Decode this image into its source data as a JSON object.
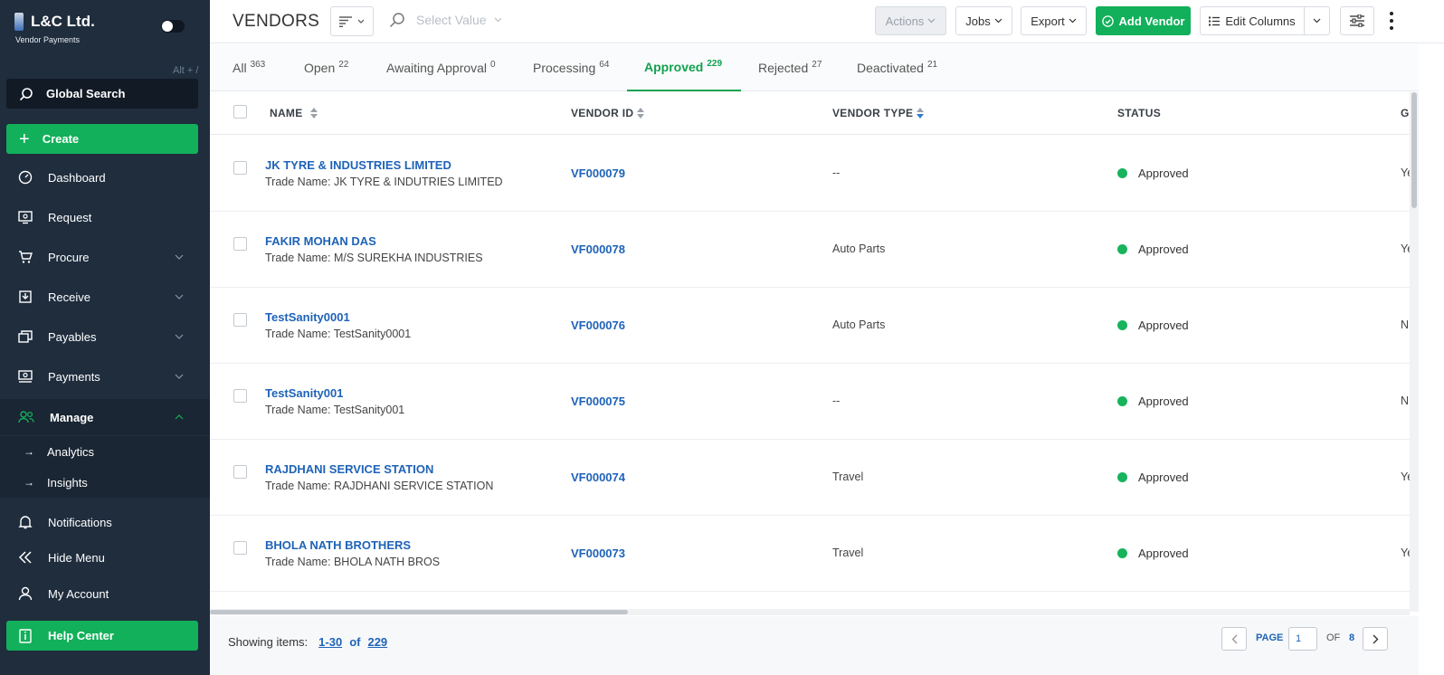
{
  "sidebar": {
    "brand_name": "L&C Ltd.",
    "brand_sub": "Vendor Payments",
    "shortcut": "Alt + /",
    "global_search": "Global Search",
    "create": "Create",
    "items": [
      {
        "label": "Dashboard",
        "icon": "dashboard-icon"
      },
      {
        "label": "Request",
        "icon": "request-icon"
      },
      {
        "label": "Procure",
        "icon": "cart-icon",
        "expandable": true
      },
      {
        "label": "Receive",
        "icon": "receive-icon",
        "expandable": true
      },
      {
        "label": "Payables",
        "icon": "payables-icon",
        "expandable": true
      },
      {
        "label": "Payments",
        "icon": "payments-icon",
        "expandable": true
      },
      {
        "label": "Manage",
        "icon": "users-icon",
        "expanded": true
      }
    ],
    "sub_items": [
      "Analytics",
      "Insights"
    ],
    "bottom": [
      {
        "label": "Notifications",
        "icon": "bell-icon"
      },
      {
        "label": "Hide Menu",
        "icon": "double-chevron-left-icon"
      },
      {
        "label": "My Account",
        "icon": "user-icon"
      }
    ],
    "help_center": "Help Center"
  },
  "header": {
    "title": "VENDORS",
    "select_placeholder": "Select Value",
    "actions": "Actions",
    "jobs": "Jobs",
    "export": "Export",
    "add_vendor": "Add Vendor",
    "edit_columns": "Edit Columns"
  },
  "tabs": [
    {
      "label": "All",
      "count": "363"
    },
    {
      "label": "Open",
      "count": "22"
    },
    {
      "label": "Awaiting Approval",
      "count": "0"
    },
    {
      "label": "Processing",
      "count": "64"
    },
    {
      "label": "Approved",
      "count": "229",
      "active": true
    },
    {
      "label": "Rejected",
      "count": "27"
    },
    {
      "label": "Deactivated",
      "count": "21"
    }
  ],
  "table": {
    "columns": [
      "NAME",
      "VENDOR ID",
      "VENDOR TYPE",
      "STATUS",
      "G"
    ],
    "rows": [
      {
        "name": "JK TYRE & INDUSTRIES LIMITED",
        "trade": "Trade Name: JK TYRE & INDUTRIES LIMITED",
        "vendor_id": "VF000079",
        "type": "--",
        "status": "Approved",
        "g": "Ye"
      },
      {
        "name": "FAKIR MOHAN DAS",
        "trade": "Trade Name: M/S SUREKHA INDUSTRIES",
        "vendor_id": "VF000078",
        "type": "Auto Parts",
        "status": "Approved",
        "g": "Ye"
      },
      {
        "name": "TestSanity0001",
        "trade": "Trade Name: TestSanity0001",
        "vendor_id": "VF000076",
        "type": "Auto Parts",
        "status": "Approved",
        "g": "N"
      },
      {
        "name": "TestSanity001",
        "trade": "Trade Name: TestSanity001",
        "vendor_id": "VF000075",
        "type": "--",
        "status": "Approved",
        "g": "N"
      },
      {
        "name": "RAJDHANI SERVICE STATION",
        "trade": "Trade Name: RAJDHANI SERVICE STATION",
        "vendor_id": "VF000074",
        "type": "Travel",
        "status": "Approved",
        "g": "Ye"
      },
      {
        "name": "BHOLA NATH BROTHERS",
        "trade": "Trade Name: BHOLA NATH BROS",
        "vendor_id": "VF000073",
        "type": "Travel",
        "status": "Approved",
        "g": "Ye"
      }
    ]
  },
  "footer": {
    "showing_label": "Showing items:",
    "range": "1-30",
    "of": "of",
    "total": "229",
    "page_label": "PAGE",
    "page_value": "1",
    "of_label": "OF",
    "total_pages": "8"
  },
  "colors": {
    "sidebar_bg": "#1f2d3d",
    "accent_green": "#12b05a",
    "link_blue": "#1e63b8"
  }
}
